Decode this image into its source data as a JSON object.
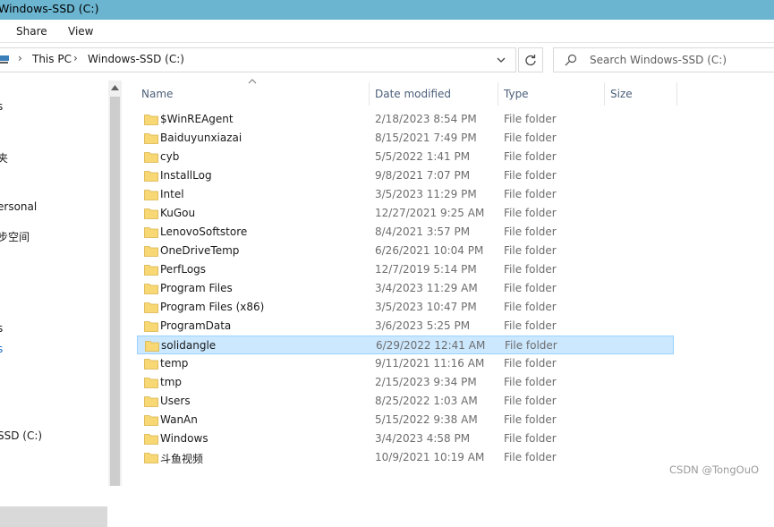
{
  "window": {
    "title": "Windows-SSD (C:)"
  },
  "ribbon": {
    "tabs": [
      {
        "label": "Share"
      },
      {
        "label": "View"
      }
    ]
  },
  "address": {
    "breadcrumb": [
      {
        "label": "This PC"
      },
      {
        "label": "Windows-SSD (C:)"
      }
    ],
    "separator": "›"
  },
  "search": {
    "placeholder": "Search Windows-SSD (C:)"
  },
  "navpane": {
    "items": [
      {
        "label": "s"
      },
      {
        "label": "夹"
      },
      {
        "label": "ersonal"
      },
      {
        "label": "步空间"
      },
      {
        "label": "s"
      },
      {
        "label": "s"
      },
      {
        "label": "SSD (C:)"
      }
    ]
  },
  "columns": {
    "name": "Name",
    "date": "Date modified",
    "type": "Type",
    "size": "Size"
  },
  "files": [
    {
      "name": "$WinREAgent",
      "date": "2/18/2023 8:54 PM",
      "type": "File folder",
      "icon": "folder-icon"
    },
    {
      "name": "Baiduyunxiazai",
      "date": "8/15/2021 7:49 PM",
      "type": "File folder",
      "icon": "folder-icon"
    },
    {
      "name": "cyb",
      "date": "5/5/2022 1:41 PM",
      "type": "File folder",
      "icon": "folder-icon"
    },
    {
      "name": "InstallLog",
      "date": "9/8/2021 7:07 PM",
      "type": "File folder",
      "icon": "folder-icon"
    },
    {
      "name": "Intel",
      "date": "3/5/2023 11:29 PM",
      "type": "File folder",
      "icon": "folder-icon"
    },
    {
      "name": "KuGou",
      "date": "12/27/2021 9:25 AM",
      "type": "File folder",
      "icon": "folder-icon"
    },
    {
      "name": "LenovoSoftstore",
      "date": "8/4/2021 3:57 PM",
      "type": "File folder",
      "icon": "folder-icon"
    },
    {
      "name": "OneDriveTemp",
      "date": "6/26/2021 10:04 PM",
      "type": "File folder",
      "icon": "folder-icon"
    },
    {
      "name": "PerfLogs",
      "date": "12/7/2019 5:14 PM",
      "type": "File folder",
      "icon": "folder-icon"
    },
    {
      "name": "Program Files",
      "date": "3/4/2023 11:29 AM",
      "type": "File folder",
      "icon": "folder-icon"
    },
    {
      "name": "Program Files (x86)",
      "date": "3/5/2023 10:47 PM",
      "type": "File folder",
      "icon": "folder-icon"
    },
    {
      "name": "ProgramData",
      "date": "3/6/2023 5:25 PM",
      "type": "File folder",
      "icon": "folder-icon"
    },
    {
      "name": "solidangle",
      "date": "6/29/2022 12:41 AM",
      "type": "File folder",
      "icon": "folder-icon",
      "selected": true
    },
    {
      "name": "temp",
      "date": "9/11/2021 11:16 AM",
      "type": "File folder",
      "icon": "folder-icon"
    },
    {
      "name": "tmp",
      "date": "2/15/2023 9:34 PM",
      "type": "File folder",
      "icon": "folder-icon"
    },
    {
      "name": "Users",
      "date": "8/25/2022 1:03 AM",
      "type": "File folder",
      "icon": "folder-icon"
    },
    {
      "name": "WanAn",
      "date": "5/15/2022 9:38 AM",
      "type": "File folder",
      "icon": "folder-icon"
    },
    {
      "name": "Windows",
      "date": "3/4/2023 4:58 PM",
      "type": "File folder",
      "icon": "folder-icon"
    },
    {
      "name": "斗鱼视频",
      "date": "10/9/2021 10:19 AM",
      "type": "File folder",
      "icon": "folder-icon"
    }
  ],
  "watermark": "CSDN @TongOuO",
  "colors": {
    "titlebar": "#6bb5d1",
    "selection": "#cce8ff",
    "selection_border": "#99d1ff",
    "folder": "#f8d775"
  }
}
